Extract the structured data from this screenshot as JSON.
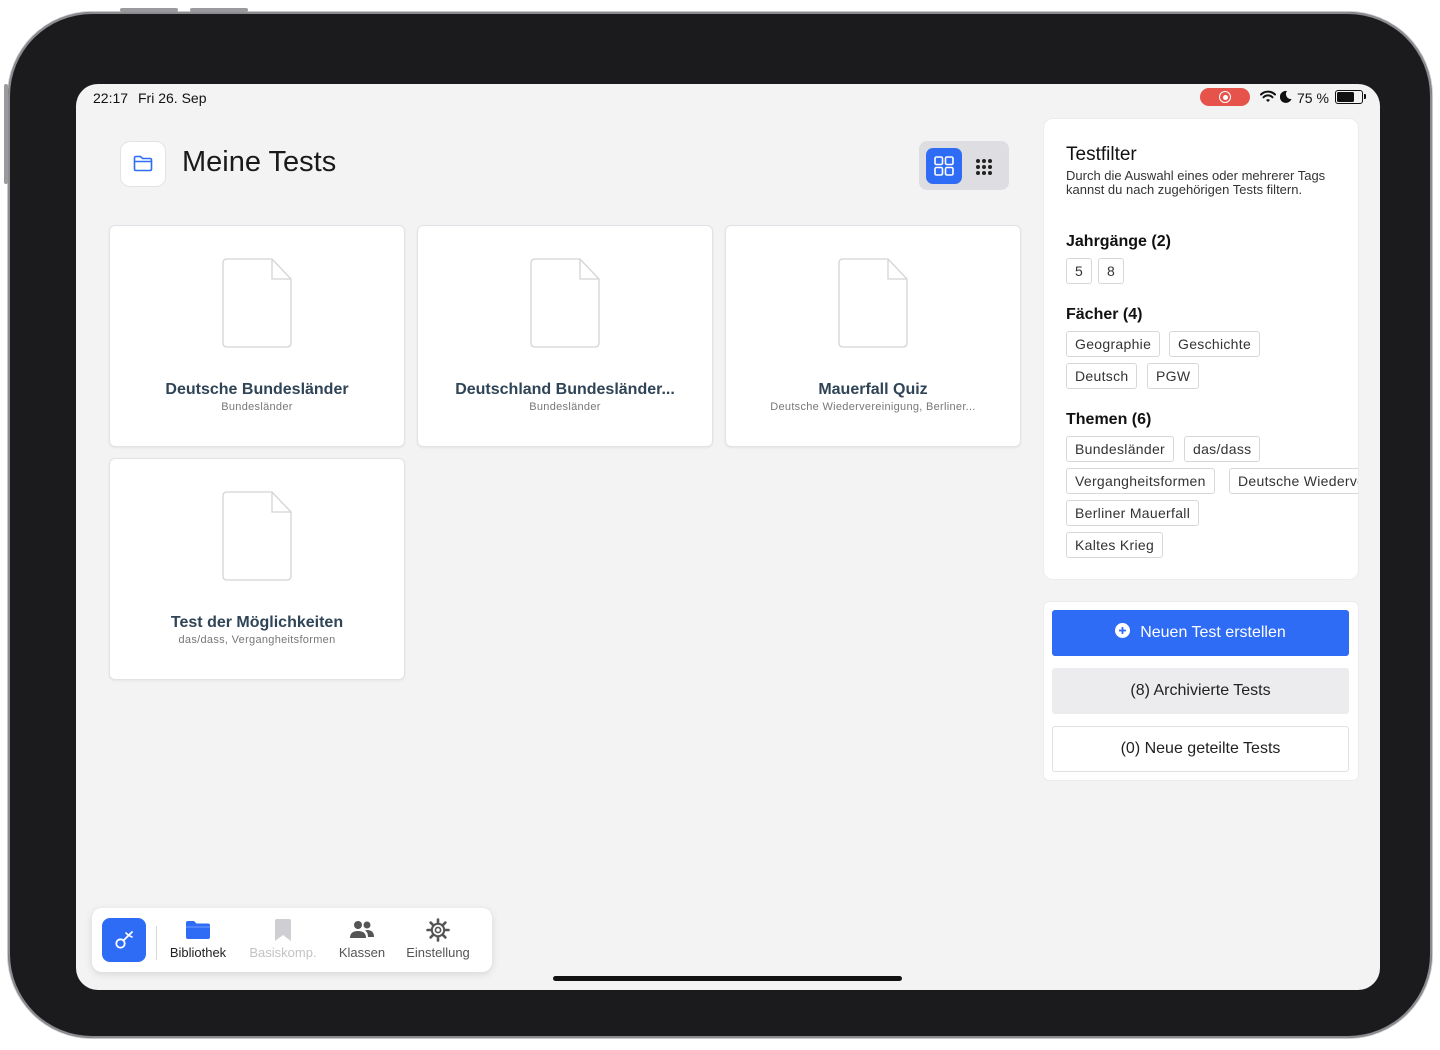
{
  "status_bar": {
    "time": "22:17",
    "date": "Fri 26. Sep",
    "battery_percent": "75 %",
    "battery_level": 0.75
  },
  "header": {
    "title": "Meine Tests"
  },
  "tests": [
    {
      "title": "Deutsche Bundesländer",
      "subtitle": "Bundesländer"
    },
    {
      "title": "Deutschland Bundesländer...",
      "subtitle": "Bundesländer"
    },
    {
      "title": "Mauerfall Quiz",
      "subtitle": "Deutsche Wiedervereinigung, Berliner..."
    },
    {
      "title": "Test der Möglichkeiten",
      "subtitle": "das/dass, Vergangheitsformen"
    }
  ],
  "filter": {
    "title": "Testfilter",
    "description": "Durch die Auswahl eines oder mehrerer Tags kannst du nach zugehörigen Tests filtern.",
    "jahrgaenge": {
      "label": "Jahrgänge (2)",
      "tags": [
        "5",
        "8"
      ]
    },
    "faecher": {
      "label": "Fächer (4)",
      "tags": [
        "Geographie",
        "Geschichte",
        "Deutsch",
        "PGW"
      ]
    },
    "themen": {
      "label": "Themen (6)",
      "tags": [
        "Bundesländer",
        "das/dass",
        "Vergangheitsformen",
        "Deutsche Wiedervereinigung",
        "Berliner Mauerfall",
        "Kaltes Krieg"
      ]
    }
  },
  "actions": {
    "create": "Neuen Test erstellen",
    "archived": "(8) Archivierte Tests",
    "shared": "(0) Neue geteilte Tests"
  },
  "tabbar": {
    "items": [
      {
        "label": "Bibliothek",
        "icon": "folder-icon",
        "state": "active"
      },
      {
        "label": "Basiskomp.",
        "icon": "bookmark-icon",
        "state": "disabled"
      },
      {
        "label": "Klassen",
        "icon": "people-icon",
        "state": "normal"
      },
      {
        "label": "Einstellung",
        "icon": "gear-icon",
        "state": "normal"
      }
    ]
  },
  "colors": {
    "accent": "#2f6cf6",
    "recording": "#e5534b",
    "card_title": "#2f4456"
  }
}
